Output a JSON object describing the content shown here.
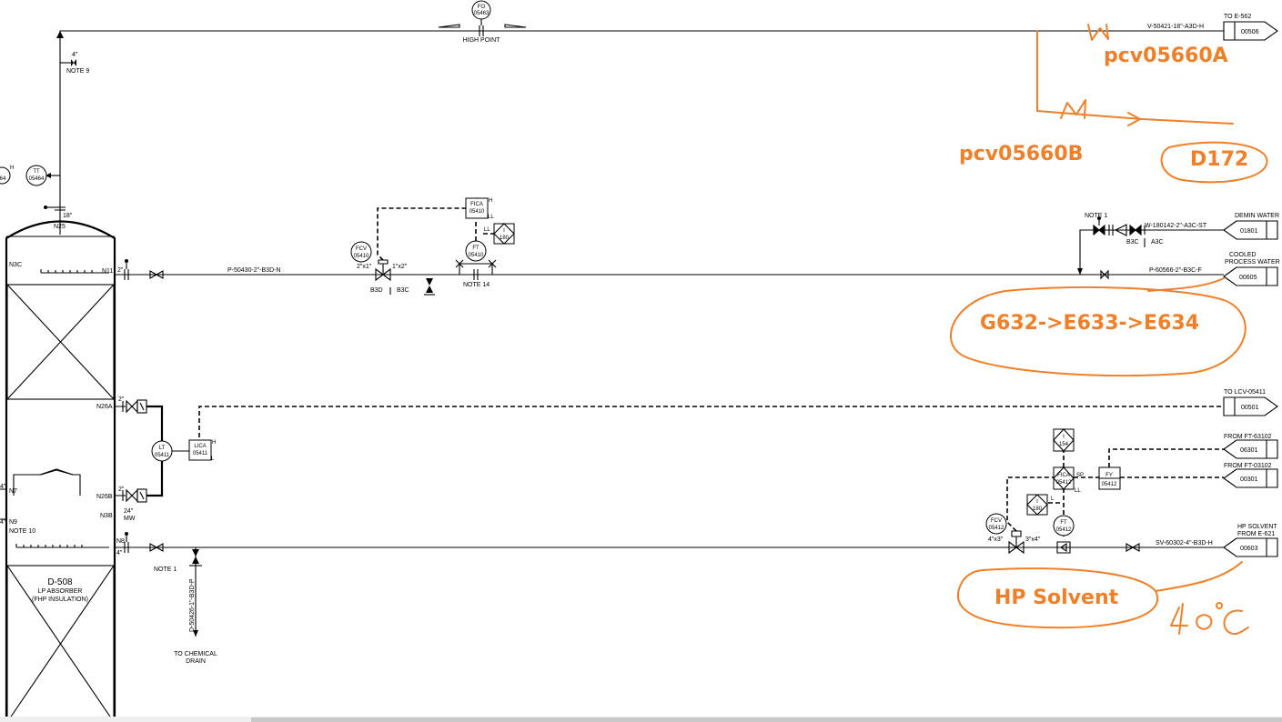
{
  "vessel": {
    "tag": "D-508",
    "name": "LP ABSORBER",
    "insulation": "(FHP INSULATION)"
  },
  "nozzles": {
    "n25": "N25",
    "n25_size": "18\"",
    "n3c": "N3C",
    "n11": "N11",
    "n11_size": "2\"",
    "n26a": "N26A",
    "n26a_size": "2\"",
    "n26b": "N26B",
    "n26b_size": "2\"",
    "n3b": "N3B",
    "n3b_size": "24\"",
    "n3b_mw": "MW",
    "n7": "N7",
    "n7_size": "4\"",
    "n9": "N9",
    "n9_size": "4\"",
    "n8": "N8",
    "n8_size": "4\"",
    "note10": "NOTE 10"
  },
  "top_line": {
    "vent_size": "4\"",
    "note9": "NOTE 9",
    "high_point": "HIGH POINT",
    "line_number": "V-50421-18\"-A3D-H",
    "dest_label": "TO E-562",
    "offpage": "00506"
  },
  "instruments": {
    "fo": {
      "func": "FO",
      "num": "05463"
    },
    "tt": {
      "func": "TT",
      "num": "05464"
    },
    "tt_partial": "64",
    "fcv_05410": {
      "func": "FCV",
      "num": "05410"
    },
    "fica_05410": {
      "func": "FICA",
      "num": "05410"
    },
    "ft_05410": {
      "func": "FT",
      "num": "05410"
    },
    "lt_05411": {
      "func": "LT",
      "num": "05411"
    },
    "lica_05411": {
      "func": "LICA",
      "num": "05411"
    },
    "fcv_05412": {
      "func": "FCV",
      "num": "05412"
    },
    "fica_05412": {
      "func": "FICA",
      "num": "05412"
    },
    "ft_05412": {
      "func": "FT",
      "num": "05412"
    },
    "fy_05412": {
      "func": "FY",
      "num": "05412"
    },
    "i180a": "180",
    "i180b": "180",
    "i154": "154",
    "i_letter": "I",
    "h": "H",
    "l": "L",
    "ll": "LL",
    "sp": "SP"
  },
  "line_2in": {
    "line_number": "P-50430-2\"-B3D-N",
    "valve_in": "2\"x1\"",
    "valve_out": "1\"x2\"",
    "spec_left": "B3D",
    "spec_right": "B3C",
    "note14": "NOTE 14"
  },
  "demin": {
    "note1": "NOTE 1",
    "line_number": "W-180142-2\"-A3C-ST",
    "spec_left": "B3C",
    "spec_right": "A3C",
    "dest_label": "DEMIN WATER",
    "offpage": "01801"
  },
  "cooled": {
    "line_number": "P-60566-2\"-B3C-F",
    "dest_label_1": "COOLED",
    "dest_label_2": "PROCESS WATER",
    "offpage": "00605"
  },
  "lcv": {
    "dest_label": "TO LCV-05411",
    "offpage": "00501"
  },
  "from_ft_1": {
    "label": "FROM FT-63102",
    "offpage": "06301"
  },
  "from_ft_2": {
    "label": "FROM FT-03102",
    "offpage": "00301"
  },
  "hp": {
    "line_number": "SV-60302-4\"-B3D-H",
    "dest_label_1": "HP SOLVENT",
    "dest_label_2": "FROM E-621",
    "offpage": "00603",
    "valve_in": "4\"x3\"",
    "valve_out": "3\"x4\""
  },
  "drain": {
    "note1": "NOTE 1",
    "line_number": "D-50426-1\"-B3D-P",
    "label_1": "TO CHEMICAL",
    "label_2": "DRAIN"
  },
  "annotations": {
    "pcv_a": "pcv05660A",
    "pcv_b": "pcv05660B",
    "d172": "D172",
    "route": "G632->E633->E634",
    "hp_solvent": "HP Solvent"
  },
  "colors": {
    "annotation": "#f07f28",
    "linework": "#000000"
  }
}
